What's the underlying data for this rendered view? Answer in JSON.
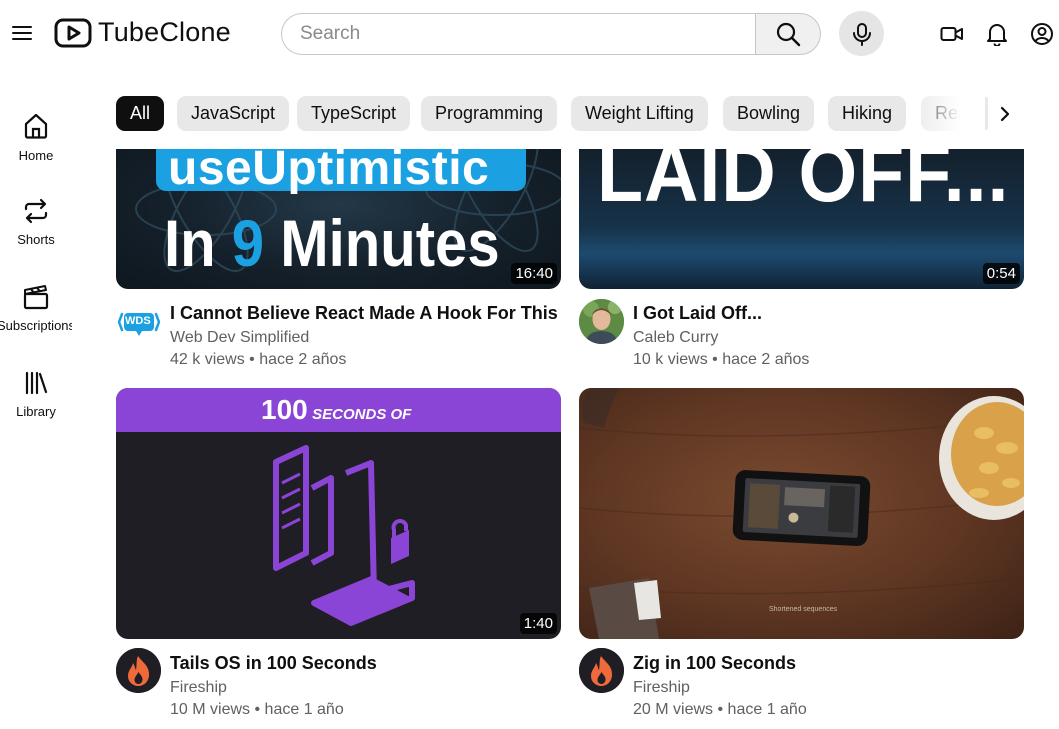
{
  "header": {
    "app_name": "TubeClone",
    "search_placeholder": "Search"
  },
  "sidebar": {
    "items": [
      {
        "label": "Home",
        "icon": "home-icon"
      },
      {
        "label": "Shorts",
        "icon": "repeat-icon"
      },
      {
        "label": "Subscriptions",
        "icon": "clapperboard-icon"
      },
      {
        "label": "Library",
        "icon": "library-icon"
      }
    ]
  },
  "categories": [
    "All",
    "JavaScript",
    "TypeScript",
    "Programming",
    "Weight Lifting",
    "Bowling",
    "Hiking",
    "Reac"
  ],
  "videos": [
    {
      "title": "I Cannot Believe React Made A Hook For This",
      "channel": "Web Dev Simplified",
      "views": "42 k views",
      "age": "hace 2 años",
      "duration": "16:40",
      "thumb_line1": "useUptimistic",
      "thumb_line2a": "In",
      "thumb_line2b": "9",
      "thumb_line2c": "Minutes",
      "avatar_text": "WDS"
    },
    {
      "title": "I Got Laid Off...",
      "channel": "Caleb Curry",
      "views": "10 k views",
      "age": "hace 2 años",
      "duration": "0:54",
      "thumb_line1": "LAID OFF..."
    },
    {
      "title": "Tails OS in 100 Seconds",
      "channel": "Fireship",
      "views": "10 M views",
      "age": "hace 1 año",
      "duration": "1:40",
      "thumb_banner_num": "100",
      "thumb_banner_text": "SECONDS OF"
    },
    {
      "title": "Zig in 100 Seconds",
      "channel": "Fireship",
      "views": "20 M views",
      "age": "hace 1 año",
      "thumb_caption": "Shortened sequences"
    }
  ],
  "meta_separator": "•",
  "colors": {
    "accent": "#0f0f0f",
    "chip_bg": "#e8e8e8",
    "fireship_bg": "#1e1e24",
    "fireship_purple": "#8b45d6",
    "react_blue": "#1ba1e2"
  }
}
